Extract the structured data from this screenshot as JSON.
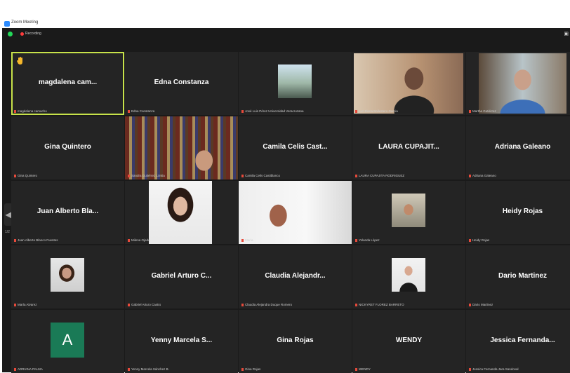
{
  "window": {
    "title": "Zoom Meeting"
  },
  "toolbar": {
    "recording_label": "Recording"
  },
  "pagination": {
    "page_left": "1/2"
  },
  "tiles": [
    {
      "display": "magdalena cam...",
      "label": "magdalena camacho",
      "active": true,
      "hand": true
    },
    {
      "display": "Edna Constanza",
      "label": "Edna Constanza"
    },
    {
      "display": "",
      "label": "José Luis Pérez Universidad Veracruzana",
      "video": "photo-group"
    },
    {
      "display": "",
      "label": "Luz Elena Ballestero Garcia",
      "video": "woman-glasses-room"
    },
    {
      "display": "",
      "label": "Martha Gutiérrez",
      "video": "woman-bookshelf"
    },
    {
      "display": "Gina Quintero",
      "label": "Gina Quintero"
    },
    {
      "display": "",
      "label": "Sandra Gutiérrez Lóntia",
      "video": "man-bookshelf"
    },
    {
      "display": "Camila Celis Cast...",
      "label": "Camila Celis Castiblanco"
    },
    {
      "display": "LAURA CUPAJIT...",
      "label": "LAURA CUPAJITA RODRIGUEZ"
    },
    {
      "display": "Adriana Galeano",
      "label": "Adriana Galeano"
    },
    {
      "display": "Juan Alberto Bla...",
      "label": "Juan Alberto Blanco Fuentes"
    },
    {
      "display": "",
      "label": "Milena Ojeda",
      "video": "woman-portrait"
    },
    {
      "display": "",
      "label": "María",
      "video": "woman-bright-room"
    },
    {
      "display": "",
      "label": "Yolanda López",
      "video": "woman-sunglasses"
    },
    {
      "display": "Heidy Rojas",
      "label": "Heidy Rojas"
    },
    {
      "display": "",
      "label": "María Alvarez",
      "video": "woman-portrait-2"
    },
    {
      "display": "Gabriel Arturo C...",
      "label": "Gabriel Arturo Castro"
    },
    {
      "display": "Claudia Alejandr...",
      "label": "Claudia Alejandra Duque Romero"
    },
    {
      "display": "",
      "label": "NICKYRET FLOREZ BARRETO",
      "video": "woman-dark-dress"
    },
    {
      "display": "Dario Martinez",
      "label": "Dario Martinez"
    },
    {
      "display": "",
      "label": "ADRIANA PALMA",
      "avatar": "A"
    },
    {
      "display": "Yenny Marcela S...",
      "label": "Yenny Marcela Sánchez B."
    },
    {
      "display": "Gina Rojas",
      "label": "Gina Rojas"
    },
    {
      "display": "WENDY",
      "label": "WENDY"
    },
    {
      "display": "Jessica Fernanda...",
      "label": "Jessica Fernanda Jara Sandoval"
    }
  ],
  "colors": {
    "active_border": "#c7e24a",
    "mic_muted": "#e64a3b",
    "avatar_bg": "#1a7a56",
    "background": "#1a1a1a",
    "tile": "#242424"
  }
}
